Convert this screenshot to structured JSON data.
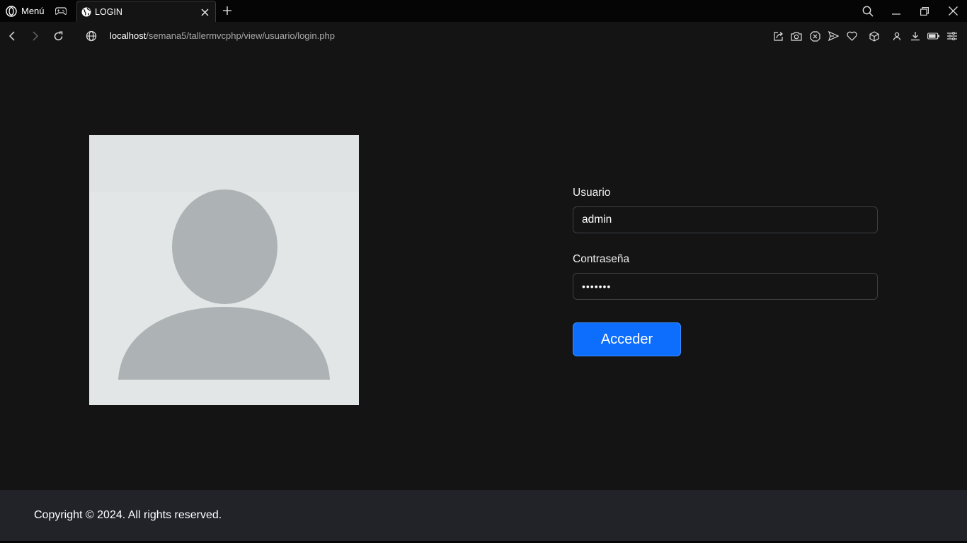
{
  "browser": {
    "menu_label": "Menú",
    "tab_title": "LOGIN",
    "url_host": "localhost",
    "url_path": "/semana5/tallermvcphp/view/usuario/login.php"
  },
  "form": {
    "user_label": "Usuario",
    "user_value": "admin",
    "password_label": "Contraseña",
    "password_value": "•••••••",
    "submit_label": "Acceder"
  },
  "footer": {
    "text": "Copyright © 2024. All rights reserved."
  },
  "colors": {
    "page_bg": "#141415",
    "footer_bg": "#212329",
    "primary_button": "#0d6efd",
    "avatar_bg": "#dfe3e3",
    "avatar_figure": "#adb3b5"
  },
  "icons": {
    "menu": "opera-logo-icon",
    "gamer": "gamepad-icon",
    "tab_site": "globe-icon",
    "tab_close": "close-icon",
    "new_tab": "plus-icon",
    "search": "search-icon",
    "minimize": "minimize-icon",
    "restore": "restore-icon",
    "close_window": "close-window-icon",
    "back": "chevron-left-icon",
    "forward": "chevron-right-icon",
    "reload": "reload-icon",
    "toolbar": [
      "share-icon",
      "camera-icon",
      "adblock-icon",
      "send-icon",
      "heart-icon",
      "cube-icon",
      "profile-icon",
      "download-icon",
      "battery-icon",
      "easy-setup-icon"
    ]
  }
}
